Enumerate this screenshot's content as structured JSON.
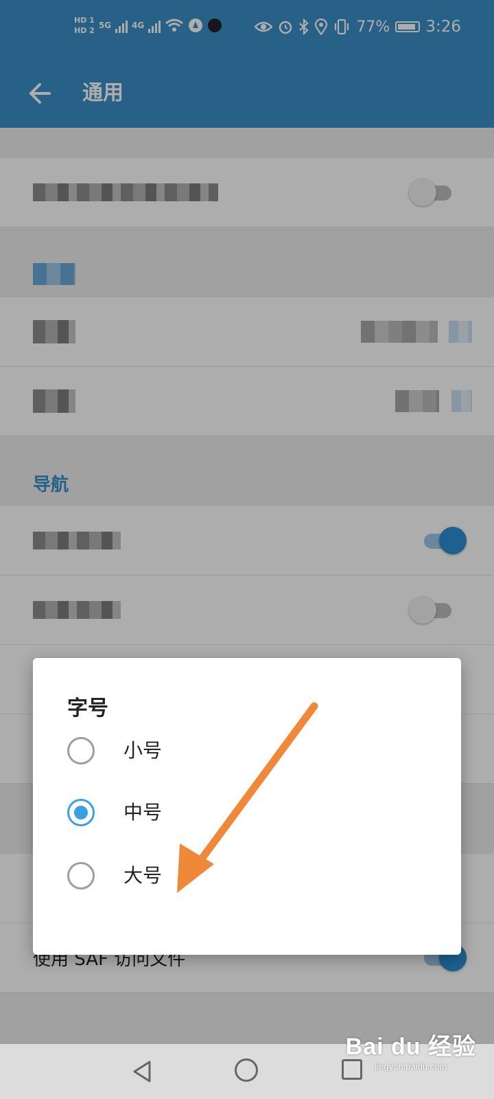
{
  "status_bar": {
    "hd1": "HD 1",
    "hd2": "HD 2",
    "net1": "5G",
    "net2": "4G",
    "battery_percent": "77%",
    "battery_level": 0.77,
    "time": "3:26",
    "icons": [
      "eye-icon",
      "alarm-icon",
      "bluetooth-icon",
      "location-icon",
      "vibrate-icon"
    ]
  },
  "app_bar": {
    "title": "通用"
  },
  "settings": {
    "section_navigation": "导航",
    "saf_label": "使用 SAF 访问文件"
  },
  "dialog": {
    "title": "字号",
    "options": [
      {
        "label": "小号",
        "checked": false
      },
      {
        "label": "中号",
        "checked": true
      },
      {
        "label": "大号",
        "checked": false
      }
    ]
  },
  "watermark": {
    "brand": "Bai du 经验",
    "url": "jingyan.baidu.com"
  },
  "colors": {
    "primary": "#3a8fc7",
    "accent": "#3aa0e3",
    "annotation_arrow": "#f0883a"
  }
}
